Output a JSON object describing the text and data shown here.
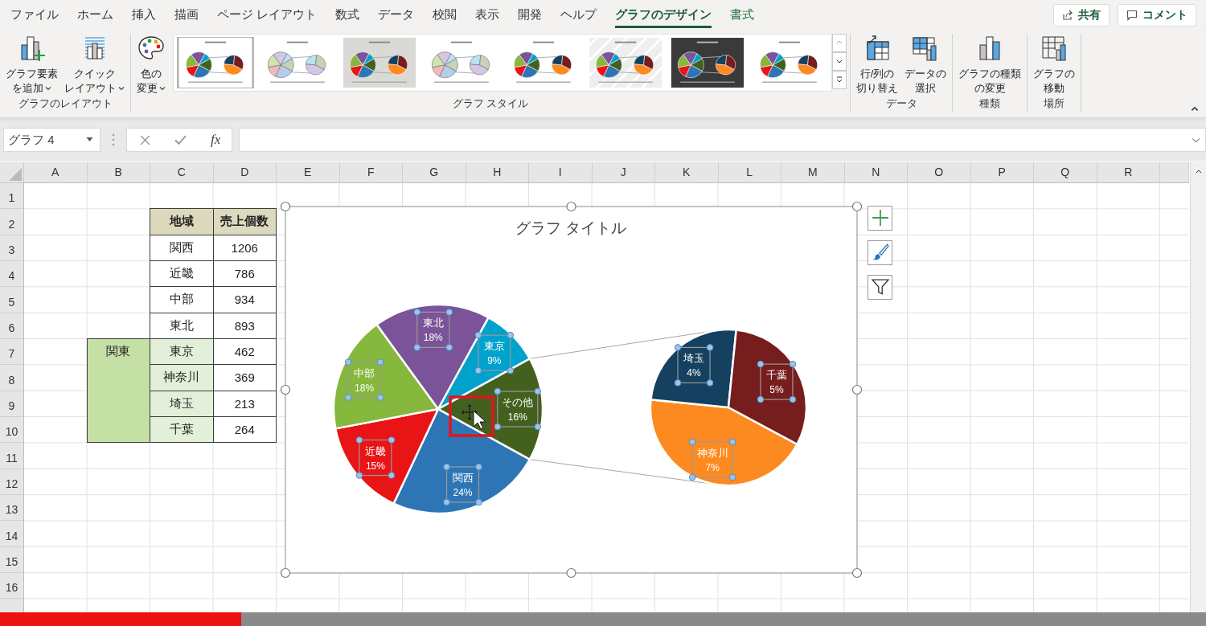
{
  "ribbon_tabs": [
    {
      "label": "ファイル",
      "selected": false,
      "contextual": false
    },
    {
      "label": "ホーム",
      "selected": false,
      "contextual": false
    },
    {
      "label": "挿入",
      "selected": false,
      "contextual": false
    },
    {
      "label": "描画",
      "selected": false,
      "contextual": false
    },
    {
      "label": "ページ レイアウト",
      "selected": false,
      "contextual": false
    },
    {
      "label": "数式",
      "selected": false,
      "contextual": false
    },
    {
      "label": "データ",
      "selected": false,
      "contextual": false
    },
    {
      "label": "校閲",
      "selected": false,
      "contextual": false
    },
    {
      "label": "表示",
      "selected": false,
      "contextual": false
    },
    {
      "label": "開発",
      "selected": false,
      "contextual": false
    },
    {
      "label": "ヘルプ",
      "selected": false,
      "contextual": false
    },
    {
      "label": "グラフのデザイン",
      "selected": true,
      "contextual": true
    },
    {
      "label": "書式",
      "selected": false,
      "contextual": true
    }
  ],
  "share_button": "共有",
  "comment_button": "コメント",
  "ribbon_groups": [
    {
      "label": "グラフのレイアウト",
      "buttons": [
        {
          "kind": "add-element",
          "lines": [
            "グラフ要素",
            "を追加"
          ],
          "dropdown": true
        },
        {
          "kind": "quick-layout",
          "lines": [
            "クイック",
            "レイアウト"
          ],
          "dropdown": true
        }
      ]
    },
    {
      "label": "グラフ スタイル",
      "buttons": [
        {
          "kind": "palette",
          "lines": [
            "色の",
            "変更"
          ],
          "dropdown": true
        }
      ],
      "gallery": [
        {
          "kind": "light",
          "selected": true
        },
        {
          "kind": "pastel",
          "selected": false
        },
        {
          "kind": "gray",
          "selected": false
        },
        {
          "kind": "pastel",
          "selected": false
        },
        {
          "kind": "light",
          "selected": false
        },
        {
          "kind": "hatched",
          "selected": false
        },
        {
          "kind": "dark",
          "selected": false
        },
        {
          "kind": "light",
          "selected": false
        }
      ]
    },
    {
      "label": "データ",
      "buttons": [
        {
          "kind": "switch-row-column",
          "lines": [
            "行/列の",
            "切り替え"
          ],
          "dropdown": false
        },
        {
          "kind": "select-data",
          "lines": [
            "データの",
            "選択"
          ],
          "dropdown": false
        }
      ]
    },
    {
      "label": "種類",
      "buttons": [
        {
          "kind": "change-type",
          "lines": [
            "グラフの種類",
            "の変更"
          ],
          "dropdown": false
        }
      ]
    },
    {
      "label": "場所",
      "buttons": [
        {
          "kind": "move-chart",
          "lines": [
            "グラフの",
            "移動"
          ],
          "dropdown": false
        }
      ]
    }
  ],
  "name_box": "グラフ 4",
  "function_label": "fx",
  "columns": [
    "A",
    "B",
    "C",
    "D",
    "E",
    "F",
    "G",
    "H",
    "I",
    "J",
    "K",
    "L",
    "M",
    "N",
    "O",
    "P",
    "Q",
    "R"
  ],
  "rows": [
    "1",
    "2",
    "3",
    "4",
    "5",
    "6",
    "7",
    "8",
    "9",
    "10",
    "11",
    "12",
    "13",
    "14",
    "15",
    "16"
  ],
  "table": {
    "headers": [
      "地域",
      "売上個数"
    ],
    "group_label": "関東",
    "rows": [
      {
        "region": "関西",
        "sales": "1206",
        "grouped": false
      },
      {
        "region": "近畿",
        "sales": "786",
        "grouped": false
      },
      {
        "region": "中部",
        "sales": "934",
        "grouped": false
      },
      {
        "region": "東北",
        "sales": "893",
        "grouped": false
      },
      {
        "region": "東京",
        "sales": "462",
        "grouped": true
      },
      {
        "region": "神奈川",
        "sales": "369",
        "grouped": true
      },
      {
        "region": "埼玉",
        "sales": "213",
        "grouped": true
      },
      {
        "region": "千葉",
        "sales": "264",
        "grouped": true
      }
    ]
  },
  "chart": {
    "selected": true,
    "chart_data": {
      "type": "pie",
      "title": "グラフ タイトル",
      "data_labels": true,
      "categories": [
        "関西",
        "近畿",
        "中部",
        "東北",
        "東京",
        "その他"
      ],
      "values": [
        24,
        15,
        18,
        18,
        9,
        16
      ],
      "value_labels": [
        "24%",
        "15%",
        "18%",
        "18%",
        "9%",
        "16%"
      ],
      "colors": [
        "#2e75b6",
        "#e81416",
        "#86b83e",
        "#7a5398",
        "#00a2cc",
        "#44601e"
      ]
    }
  },
  "secondary_pie": {
    "chart_data": {
      "type": "pie",
      "data_labels": true,
      "categories": [
        "神奈川",
        "埼玉",
        "千葉"
      ],
      "values": [
        7,
        4,
        5
      ],
      "value_labels": [
        "7%",
        "4%",
        "5%"
      ],
      "colors": [
        "#fd8a20",
        "#15405f",
        "#761d1e"
      ]
    }
  },
  "video_progress": {
    "level": 0.2
  }
}
